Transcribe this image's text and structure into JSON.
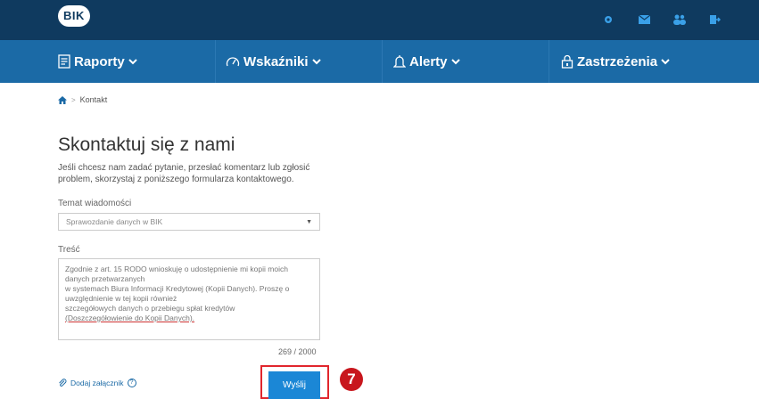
{
  "header": {
    "logo_text": "BIK",
    "icons": [
      "gear-icon",
      "mail-icon",
      "users-icon",
      "logout-icon"
    ]
  },
  "nav": {
    "items": [
      {
        "label": "Raporty",
        "icon": "document-icon"
      },
      {
        "label": "Wskaźniki",
        "icon": "gauge-icon"
      },
      {
        "label": "Alerty",
        "icon": "bell-icon"
      },
      {
        "label": "Zastrzeżenia",
        "icon": "lock-icon"
      }
    ]
  },
  "breadcrumb": {
    "separator": ">",
    "current": "Kontakt"
  },
  "page": {
    "title": "Skontaktuj się z nami",
    "description": "Jeśli chcesz nam zadać pytanie, przesłać komentarz lub zgłosić problem, skorzystaj z poniższego formularza kontaktowego."
  },
  "form": {
    "topic_label": "Temat wiadomości",
    "topic_value": "Sprawozdanie danych w BIK",
    "body_label": "Treść",
    "body_lines": [
      "Zgodnie z art. 15 RODO wnioskuję o udostępnienie mi kopii moich",
      "danych przetwarzanych",
      "w systemach Biura Informacji Kredytowej (Kopii Danych). Proszę o",
      "uwzględnienie w tej kopii również",
      "szczegółowych danych o przebiegu spłat kredytów",
      "(Doszczegółowienie do Kopii Danych)."
    ],
    "counter": "269 / 2000",
    "attach_label": "Dodaj załącznik",
    "help_label": "?",
    "send_label": "Wyślij"
  },
  "annotation": {
    "step_number": "7"
  },
  "colors": {
    "topbar": "#0f3a5f",
    "navbar": "#1b6aa6",
    "button": "#1b87d6",
    "highlight": "#e1262d"
  }
}
